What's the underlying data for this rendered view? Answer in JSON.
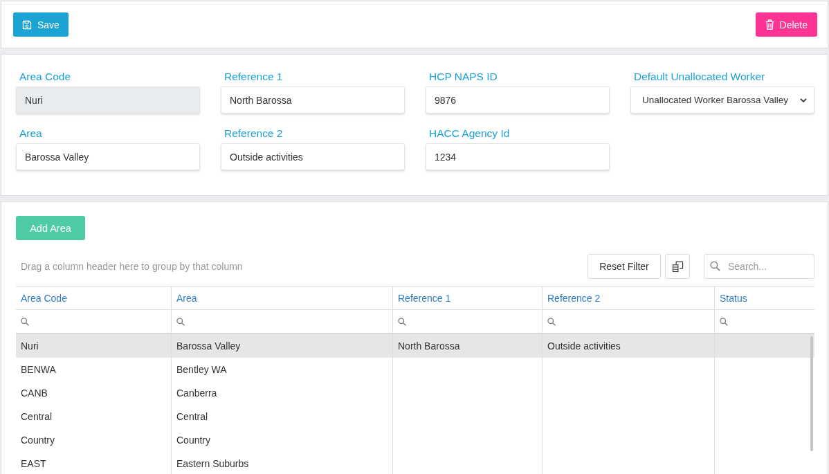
{
  "toolbar": {
    "buttons": [
      {
        "kind": "save",
        "label": "Save"
      },
      {
        "kind": "delete",
        "label": "Delete"
      }
    ]
  },
  "form": {
    "fields": [
      {
        "label": "Area Code",
        "kind": "text",
        "value": "Nuri",
        "disabled": true
      },
      {
        "label": "Reference 1",
        "kind": "text",
        "value": "North Barossa",
        "disabled": false
      },
      {
        "label": "HCP NAPS ID",
        "kind": "text",
        "value": "9876",
        "disabled": false
      },
      {
        "label": "Default Unallocated Worker",
        "kind": "select",
        "value": "Unallocated Worker Barossa Valley",
        "disabled": false
      },
      {
        "label": "Area",
        "kind": "text",
        "value": "Barossa Valley",
        "disabled": false
      },
      {
        "label": "Reference 2",
        "kind": "text",
        "value": "Outside activities",
        "disabled": false
      },
      {
        "label": "HACC Agency Id",
        "kind": "text",
        "value": "1234",
        "disabled": false
      }
    ]
  },
  "grid": {
    "add_button": "Add Area",
    "group_panel_hint": "Drag a column header here to group by that column",
    "reset_button": "Reset Filter",
    "search": {
      "placeholder": "Search..."
    },
    "columns": [
      "Area Code",
      "Area",
      "Reference 1",
      "Reference 2",
      "Status"
    ],
    "rows": [
      {
        "cells": [
          "Nuri",
          "Barossa Valley",
          "North Barossa",
          "Outside activities"
        ],
        "selected": true
      },
      {
        "cells": [
          "BENWA",
          "Bentley WA"
        ],
        "selected": false
      },
      {
        "cells": [
          "CANB",
          "Canberra"
        ],
        "selected": false
      },
      {
        "cells": [
          "Central",
          "Central"
        ],
        "selected": false
      },
      {
        "cells": [
          "Country",
          "Country"
        ],
        "selected": false
      },
      {
        "cells": [
          "EAST",
          "Eastern Suburbs"
        ],
        "selected": false
      }
    ]
  }
}
